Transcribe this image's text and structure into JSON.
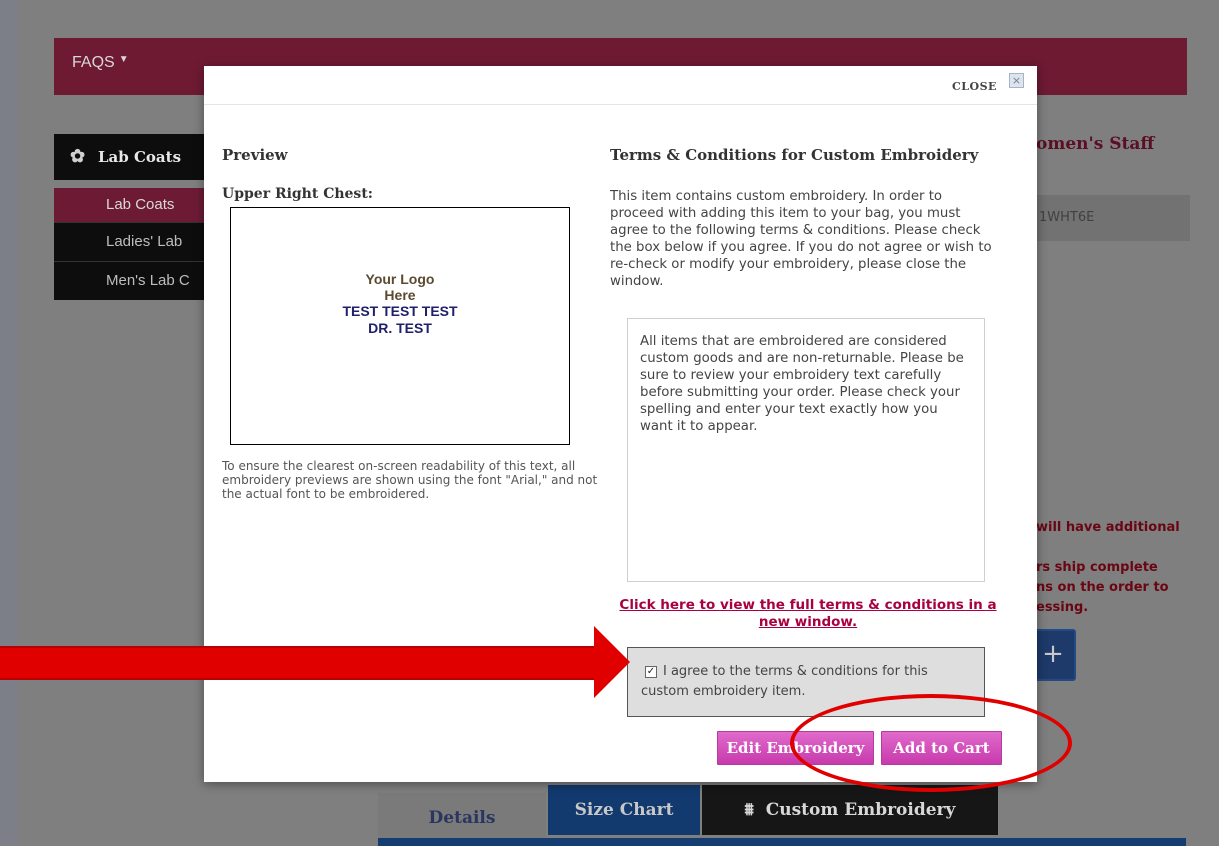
{
  "background": {
    "nav": {
      "faqs_label": "FAQS",
      "caret": "▼"
    },
    "sidebar": {
      "header": "Lab Coats",
      "items": [
        "Lab Coats",
        "Ladies' Lab",
        "Men's Lab C"
      ]
    },
    "product_title_fragment": "omen's Staff",
    "sku_fragment": "1WHT6E",
    "warning_lines": [
      "will have additional",
      "",
      "rs ship complete",
      "ns on the order to",
      "essing."
    ],
    "plus_label": "+",
    "tabs": {
      "details": "Details",
      "size_chart": "Size Chart",
      "custom_embroidery": "Custom Embroidery"
    }
  },
  "modal": {
    "close_label": "CLOSE",
    "close_icon": "×",
    "preview_heading": "Preview",
    "location_label": "Upper Right Chest:",
    "preview_lines": {
      "logo_1": "Your Logo",
      "logo_2": "Here",
      "text_1": "TEST TEST TEST",
      "text_2": "DR. TEST"
    },
    "preview_note": "To ensure the clearest on-screen readability of this text, all embroidery previews are shown using the font \"Arial,\" and not the actual font to be embroidered.",
    "terms_heading": "Terms & Conditions for Custom Embroidery",
    "terms_intro": "This item contains custom embroidery. In order to proceed with adding this item to your bag, you must agree to the following terms & conditions. Please check the box below if you agree. If you do not agree or wish to re-check or modify your embroidery, please close the window.",
    "terms_body": "All items that are embroidered are considered custom goods and are non-returnable. Please be sure to review your embroidery text carefully before submitting your order.  Please check your spelling and enter your text exactly how you want it to appear.",
    "terms_link": "Click here to view the full terms & conditions in a new window.",
    "agree_label": "I agree to the terms & conditions for this custom embroidery item.",
    "agree_checked": true,
    "edit_button": "Edit Embroidery",
    "add_to_cart_button": "Add to Cart"
  },
  "annotation_color": "#e00000"
}
